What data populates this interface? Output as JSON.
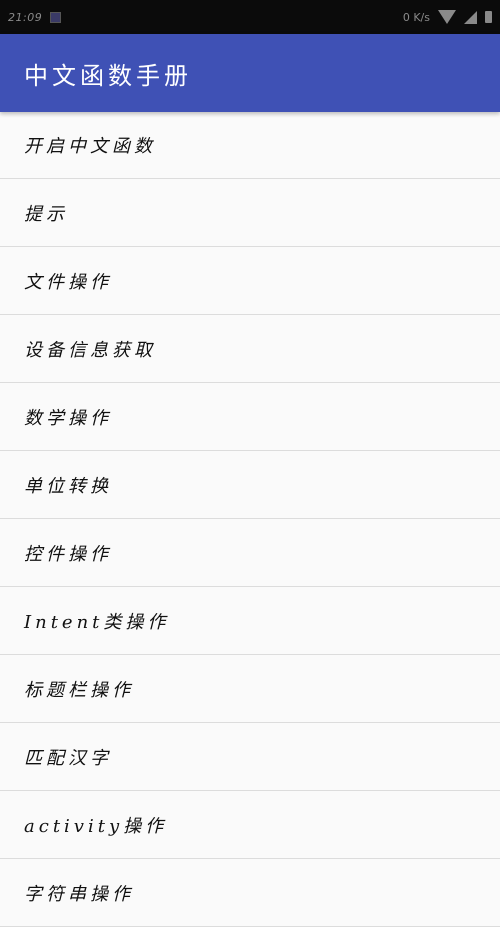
{
  "status_bar": {
    "time": "21:09",
    "network_speed": "0 K/s"
  },
  "app_bar": {
    "title": "中文函数手册"
  },
  "menu": {
    "items": [
      {
        "label": "开启中文函数"
      },
      {
        "label": "提示"
      },
      {
        "label": "文件操作"
      },
      {
        "label": "设备信息获取"
      },
      {
        "label": "数学操作"
      },
      {
        "label": "单位转换"
      },
      {
        "label": "控件操作"
      },
      {
        "label": "Intent类操作"
      },
      {
        "label": "标题栏操作"
      },
      {
        "label": "匹配汉字"
      },
      {
        "label": "activity操作"
      },
      {
        "label": "字符串操作"
      }
    ]
  },
  "colors": {
    "primary": "#3f51b5",
    "status_bar": "#0b0b0b",
    "background": "#fafafa",
    "divider": "#dcdcdc"
  }
}
